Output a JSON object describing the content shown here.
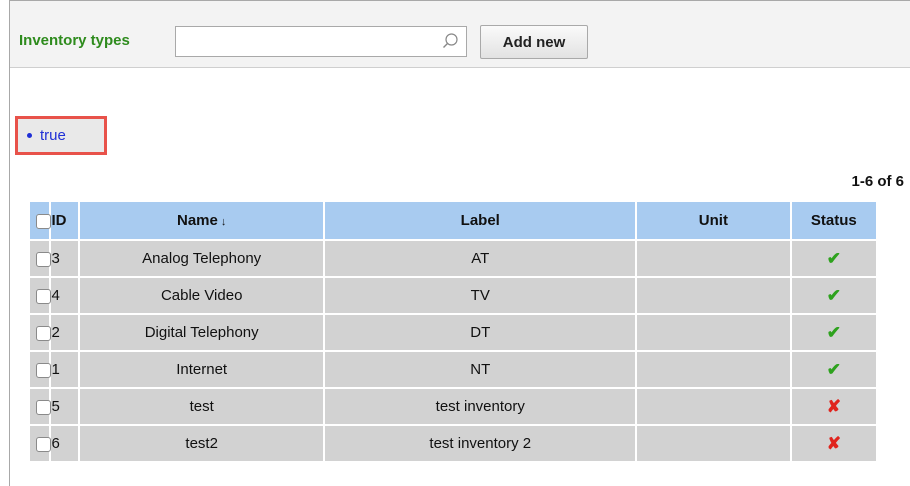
{
  "toolbar": {
    "title": "Inventory types",
    "search_value": "",
    "search_placeholder": "",
    "add_button_label": "Add new"
  },
  "filter": {
    "label": "true"
  },
  "pager": {
    "text": "1-6 of 6"
  },
  "table": {
    "headers": {
      "id": "ID",
      "name": "Name",
      "sort_icon": "↓",
      "label": "Label",
      "unit": "Unit",
      "status": "Status"
    },
    "rows": [
      {
        "id": "3",
        "name": "Analog Telephony",
        "label": "AT",
        "unit": "",
        "status": "✔",
        "status_icon": "check-icon"
      },
      {
        "id": "4",
        "name": "Cable Video",
        "label": "TV",
        "unit": "",
        "status": "✔",
        "status_icon": "check-icon"
      },
      {
        "id": "2",
        "name": "Digital Telephony",
        "label": "DT",
        "unit": "",
        "status": "✔",
        "status_icon": "check-icon"
      },
      {
        "id": "1",
        "name": "Internet",
        "label": "NT",
        "unit": "",
        "status": "✔",
        "status_icon": "check-icon"
      },
      {
        "id": "5",
        "name": "test",
        "label": "test inventory",
        "unit": "",
        "status": "✘",
        "status_icon": "cross-icon"
      },
      {
        "id": "6",
        "name": "test2",
        "label": "test inventory 2",
        "unit": "",
        "status": "✘",
        "status_icon": "cross-icon"
      }
    ]
  },
  "colors": {
    "title_green": "#2e8b1d",
    "header_blue": "#a8cbf0",
    "row_gray": "#d2d2d2",
    "highlight_red": "#e8524a",
    "link_blue": "#1f2fd6",
    "ok_green": "#2ea21e",
    "bad_red": "#e0241d"
  }
}
